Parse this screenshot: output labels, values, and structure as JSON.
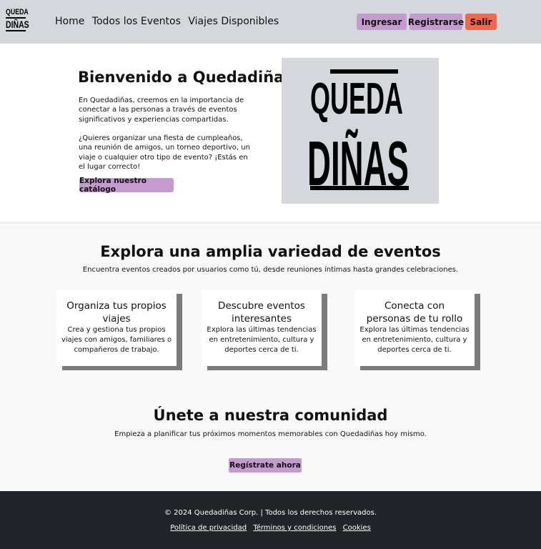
{
  "header": {
    "logo_line1": "QUEDA",
    "logo_line2": "DIÑAS",
    "nav": [
      "Home",
      "Todos los Eventos",
      "Viajes Disponibles"
    ],
    "login_label": "Ingresar",
    "register_label": "Registrarse",
    "logout_label": "Salir"
  },
  "hero": {
    "title": "Bienvenido a Quedadiñas",
    "paragraph1": "En Quedadiñas, creemos en la importancia de conectar a las personas a través de eventos significativos y experiencias compartidas.",
    "paragraph2": "¿Quieres organizar una fiesta de cumpleaños, una reunión de amigos, un torneo deportivo, un viaje o cualquier otro tipo de evento? ¡Estás en el lugar correcto!",
    "cta_label": "Explora nuestro catálogo",
    "image_line1": "QUEDA",
    "image_line2": "DIÑAS"
  },
  "features": {
    "title": "Explora una amplia variedad de eventos",
    "subtitle": "Encuentra eventos creados por usuarios como tú, desde reuniones íntimas hasta grandes celebraciones.",
    "cards": [
      {
        "title": "Organiza tus propios viajes",
        "text": "Crea y gestiona tus propios viajes con amigos, familiares o compañeros de trabajo."
      },
      {
        "title": "Descubre eventos interesantes",
        "text": "Explora las últimas tendencias en entretenimiento, cultura y deportes cerca de ti."
      },
      {
        "title": "Conecta con personas de tu rollo",
        "text": "Explora las últimas tendencias en entretenimiento, cultura y deportes cerca de ti."
      }
    ]
  },
  "community": {
    "title": "Únete a nuestra comunidad",
    "subtitle": "Empieza a planificar tus próximos momentos memorables con Quedadiñas hoy mismo.",
    "cta_label": "Regístrate ahora"
  },
  "footer": {
    "copyright": "© 2024 Quedadiñas Corp. | Todos los derechos reservados.",
    "links": [
      "Política de privacidad",
      "Términos y condiciones",
      "Cookies"
    ]
  },
  "colors": {
    "header_bg": "#d4d8dc",
    "accent": "#c49ad0",
    "logout": "#f4664e",
    "footer_bg": "#212529"
  }
}
